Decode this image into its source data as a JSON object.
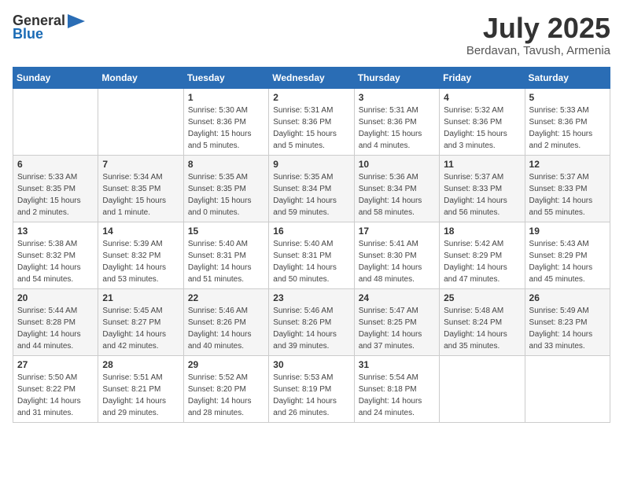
{
  "logo": {
    "general": "General",
    "blue": "Blue"
  },
  "header": {
    "month": "July 2025",
    "location": "Berdavan, Tavush, Armenia"
  },
  "weekdays": [
    "Sunday",
    "Monday",
    "Tuesday",
    "Wednesday",
    "Thursday",
    "Friday",
    "Saturday"
  ],
  "weeks": [
    [
      {
        "day": "",
        "sunrise": "",
        "sunset": "",
        "daylight": ""
      },
      {
        "day": "",
        "sunrise": "",
        "sunset": "",
        "daylight": ""
      },
      {
        "day": "1",
        "sunrise": "Sunrise: 5:30 AM",
        "sunset": "Sunset: 8:36 PM",
        "daylight": "Daylight: 15 hours and 5 minutes."
      },
      {
        "day": "2",
        "sunrise": "Sunrise: 5:31 AM",
        "sunset": "Sunset: 8:36 PM",
        "daylight": "Daylight: 15 hours and 5 minutes."
      },
      {
        "day": "3",
        "sunrise": "Sunrise: 5:31 AM",
        "sunset": "Sunset: 8:36 PM",
        "daylight": "Daylight: 15 hours and 4 minutes."
      },
      {
        "day": "4",
        "sunrise": "Sunrise: 5:32 AM",
        "sunset": "Sunset: 8:36 PM",
        "daylight": "Daylight: 15 hours and 3 minutes."
      },
      {
        "day": "5",
        "sunrise": "Sunrise: 5:33 AM",
        "sunset": "Sunset: 8:36 PM",
        "daylight": "Daylight: 15 hours and 2 minutes."
      }
    ],
    [
      {
        "day": "6",
        "sunrise": "Sunrise: 5:33 AM",
        "sunset": "Sunset: 8:35 PM",
        "daylight": "Daylight: 15 hours and 2 minutes."
      },
      {
        "day": "7",
        "sunrise": "Sunrise: 5:34 AM",
        "sunset": "Sunset: 8:35 PM",
        "daylight": "Daylight: 15 hours and 1 minute."
      },
      {
        "day": "8",
        "sunrise": "Sunrise: 5:35 AM",
        "sunset": "Sunset: 8:35 PM",
        "daylight": "Daylight: 15 hours and 0 minutes."
      },
      {
        "day": "9",
        "sunrise": "Sunrise: 5:35 AM",
        "sunset": "Sunset: 8:34 PM",
        "daylight": "Daylight: 14 hours and 59 minutes."
      },
      {
        "day": "10",
        "sunrise": "Sunrise: 5:36 AM",
        "sunset": "Sunset: 8:34 PM",
        "daylight": "Daylight: 14 hours and 58 minutes."
      },
      {
        "day": "11",
        "sunrise": "Sunrise: 5:37 AM",
        "sunset": "Sunset: 8:33 PM",
        "daylight": "Daylight: 14 hours and 56 minutes."
      },
      {
        "day": "12",
        "sunrise": "Sunrise: 5:37 AM",
        "sunset": "Sunset: 8:33 PM",
        "daylight": "Daylight: 14 hours and 55 minutes."
      }
    ],
    [
      {
        "day": "13",
        "sunrise": "Sunrise: 5:38 AM",
        "sunset": "Sunset: 8:32 PM",
        "daylight": "Daylight: 14 hours and 54 minutes."
      },
      {
        "day": "14",
        "sunrise": "Sunrise: 5:39 AM",
        "sunset": "Sunset: 8:32 PM",
        "daylight": "Daylight: 14 hours and 53 minutes."
      },
      {
        "day": "15",
        "sunrise": "Sunrise: 5:40 AM",
        "sunset": "Sunset: 8:31 PM",
        "daylight": "Daylight: 14 hours and 51 minutes."
      },
      {
        "day": "16",
        "sunrise": "Sunrise: 5:40 AM",
        "sunset": "Sunset: 8:31 PM",
        "daylight": "Daylight: 14 hours and 50 minutes."
      },
      {
        "day": "17",
        "sunrise": "Sunrise: 5:41 AM",
        "sunset": "Sunset: 8:30 PM",
        "daylight": "Daylight: 14 hours and 48 minutes."
      },
      {
        "day": "18",
        "sunrise": "Sunrise: 5:42 AM",
        "sunset": "Sunset: 8:29 PM",
        "daylight": "Daylight: 14 hours and 47 minutes."
      },
      {
        "day": "19",
        "sunrise": "Sunrise: 5:43 AM",
        "sunset": "Sunset: 8:29 PM",
        "daylight": "Daylight: 14 hours and 45 minutes."
      }
    ],
    [
      {
        "day": "20",
        "sunrise": "Sunrise: 5:44 AM",
        "sunset": "Sunset: 8:28 PM",
        "daylight": "Daylight: 14 hours and 44 minutes."
      },
      {
        "day": "21",
        "sunrise": "Sunrise: 5:45 AM",
        "sunset": "Sunset: 8:27 PM",
        "daylight": "Daylight: 14 hours and 42 minutes."
      },
      {
        "day": "22",
        "sunrise": "Sunrise: 5:46 AM",
        "sunset": "Sunset: 8:26 PM",
        "daylight": "Daylight: 14 hours and 40 minutes."
      },
      {
        "day": "23",
        "sunrise": "Sunrise: 5:46 AM",
        "sunset": "Sunset: 8:26 PM",
        "daylight": "Daylight: 14 hours and 39 minutes."
      },
      {
        "day": "24",
        "sunrise": "Sunrise: 5:47 AM",
        "sunset": "Sunset: 8:25 PM",
        "daylight": "Daylight: 14 hours and 37 minutes."
      },
      {
        "day": "25",
        "sunrise": "Sunrise: 5:48 AM",
        "sunset": "Sunset: 8:24 PM",
        "daylight": "Daylight: 14 hours and 35 minutes."
      },
      {
        "day": "26",
        "sunrise": "Sunrise: 5:49 AM",
        "sunset": "Sunset: 8:23 PM",
        "daylight": "Daylight: 14 hours and 33 minutes."
      }
    ],
    [
      {
        "day": "27",
        "sunrise": "Sunrise: 5:50 AM",
        "sunset": "Sunset: 8:22 PM",
        "daylight": "Daylight: 14 hours and 31 minutes."
      },
      {
        "day": "28",
        "sunrise": "Sunrise: 5:51 AM",
        "sunset": "Sunset: 8:21 PM",
        "daylight": "Daylight: 14 hours and 29 minutes."
      },
      {
        "day": "29",
        "sunrise": "Sunrise: 5:52 AM",
        "sunset": "Sunset: 8:20 PM",
        "daylight": "Daylight: 14 hours and 28 minutes."
      },
      {
        "day": "30",
        "sunrise": "Sunrise: 5:53 AM",
        "sunset": "Sunset: 8:19 PM",
        "daylight": "Daylight: 14 hours and 26 minutes."
      },
      {
        "day": "31",
        "sunrise": "Sunrise: 5:54 AM",
        "sunset": "Sunset: 8:18 PM",
        "daylight": "Daylight: 14 hours and 24 minutes."
      },
      {
        "day": "",
        "sunrise": "",
        "sunset": "",
        "daylight": ""
      },
      {
        "day": "",
        "sunrise": "",
        "sunset": "",
        "daylight": ""
      }
    ]
  ]
}
